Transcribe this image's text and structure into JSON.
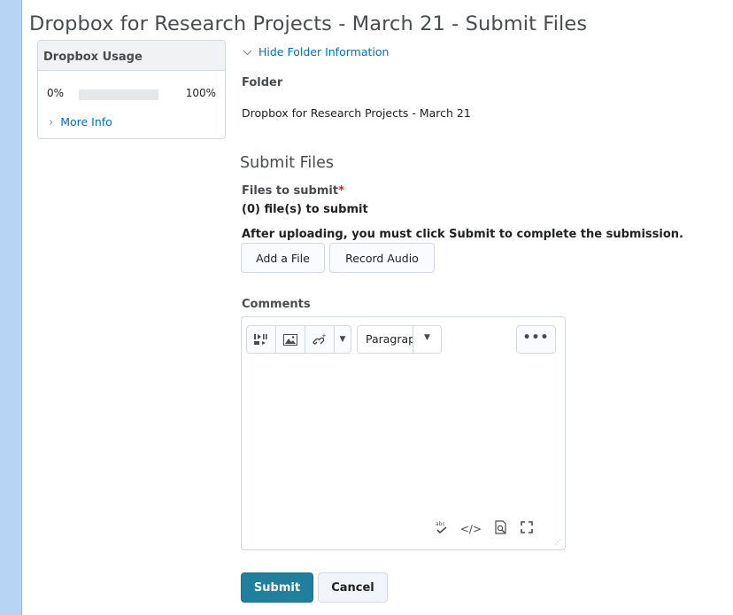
{
  "page": {
    "title": "Dropbox for Research Projects - March 21 - Submit Files"
  },
  "usage": {
    "title": "Dropbox Usage",
    "min_label": "0%",
    "max_label": "100%",
    "fill_fraction": 0.0,
    "more_info": "More Info"
  },
  "folder": {
    "hide_link": "Hide Folder Information",
    "label": "Folder",
    "name": "Dropbox for Research Projects - March 21"
  },
  "submit_files": {
    "section_title": "Submit Files",
    "files_label": "Files to submit",
    "required_marker": "*",
    "files_count": "(0) file(s) to submit",
    "after_upload_note": "After uploading, you must click Submit to complete the submission.",
    "add_file_button": "Add a File",
    "record_audio_button": "Record Audio"
  },
  "comments": {
    "label": "Comments",
    "format_select": "Paragraph",
    "more_button": "•••",
    "icons": [
      "media-icon",
      "image-icon",
      "link-icon",
      "spellcheck-icon",
      "source-code-icon",
      "preview-icon",
      "fullscreen-icon"
    ]
  },
  "actions": {
    "submit": "Submit",
    "cancel": "Cancel"
  },
  "colors": {
    "accent": "#006fbf",
    "primary_button": "#1f7f9c",
    "background": "#b8d4f5",
    "required": "#cd2026"
  }
}
